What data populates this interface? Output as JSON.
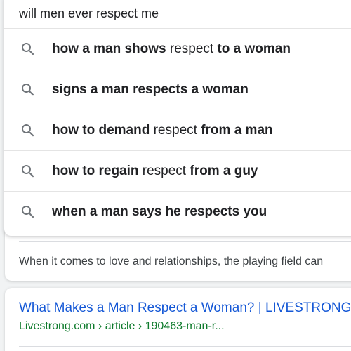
{
  "search": {
    "query": "will men ever respect me",
    "search_icon": "search-icon"
  },
  "suggestions": [
    {
      "parts": [
        {
          "text": "how a man shows",
          "bold": true
        },
        {
          "text": " respect ",
          "bold": false
        },
        {
          "text": "to a woman",
          "bold": true
        }
      ]
    },
    {
      "parts": [
        {
          "text": "signs a man respects a woman",
          "bold": true
        }
      ]
    },
    {
      "parts": [
        {
          "text": "how to demand",
          "bold": true
        },
        {
          "text": " respect ",
          "bold": false
        },
        {
          "text": "from a man",
          "bold": true
        }
      ]
    },
    {
      "parts": [
        {
          "text": "how to regain",
          "bold": true
        },
        {
          "text": " respect ",
          "bold": false
        },
        {
          "text": "from a guy",
          "bold": true
        }
      ]
    },
    {
      "parts": [
        {
          "text": "when a man says he respects you",
          "bold": true
        }
      ]
    }
  ],
  "snippet": {
    "text": "When it comes to love and relationships, the playing field can"
  },
  "result": {
    "title": "What Makes a Man Respect a Woman? | LIVESTRONG",
    "url": "Livestrong.com › article › 190463-man-r..."
  },
  "colors": {
    "link": "#1558d6",
    "url_green": "#0d7a2b",
    "text": "#202124",
    "icon": "#70757a"
  }
}
